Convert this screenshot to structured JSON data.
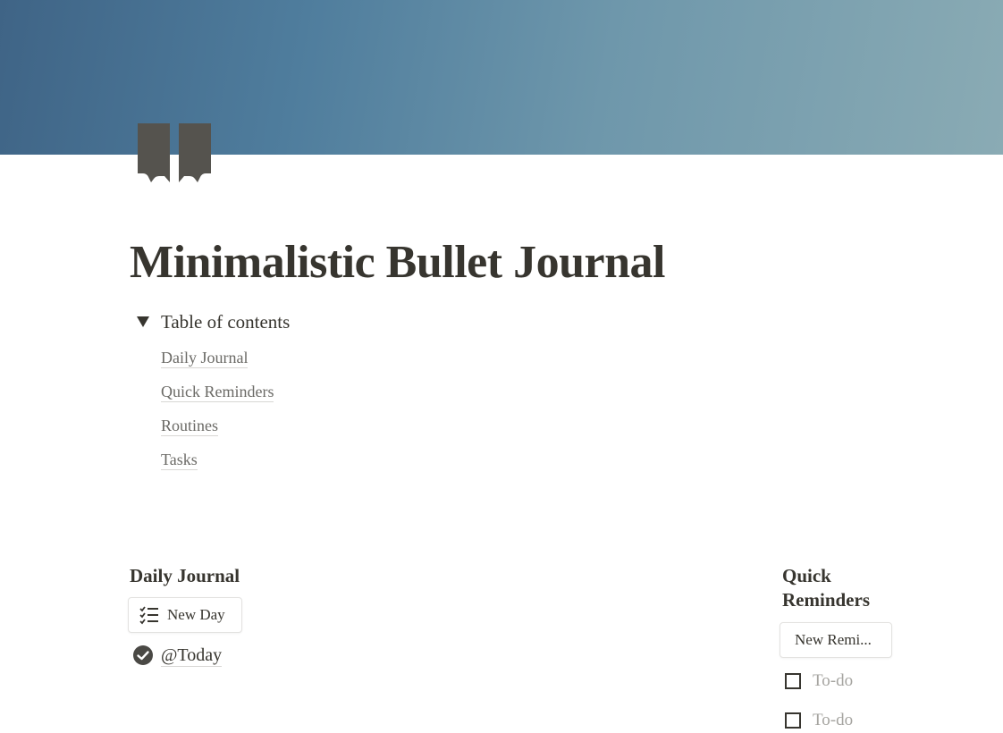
{
  "colors": {
    "cover_start": "#3f6486",
    "cover_end": "#8aabb4",
    "text": "#37352f",
    "muted": "#a5a4a0",
    "icon": "#55534e"
  },
  "page": {
    "icon": "book-icon",
    "title": "Minimalistic Bullet Journal"
  },
  "toc": {
    "heading": "Table of contents",
    "links": [
      "Daily Journal",
      "Quick Reminders",
      "Routines",
      "Tasks"
    ]
  },
  "daily_journal": {
    "title": "Daily Journal",
    "new_button": "New Day",
    "new_button_icon": "checklist-icon",
    "entry": "@Today",
    "entry_icon": "check-circle-icon"
  },
  "quick_reminders": {
    "title_line1": "Quick",
    "title_line2": "Reminders",
    "new_button": "New Remi...",
    "todos": [
      "To-do",
      "To-do"
    ]
  }
}
